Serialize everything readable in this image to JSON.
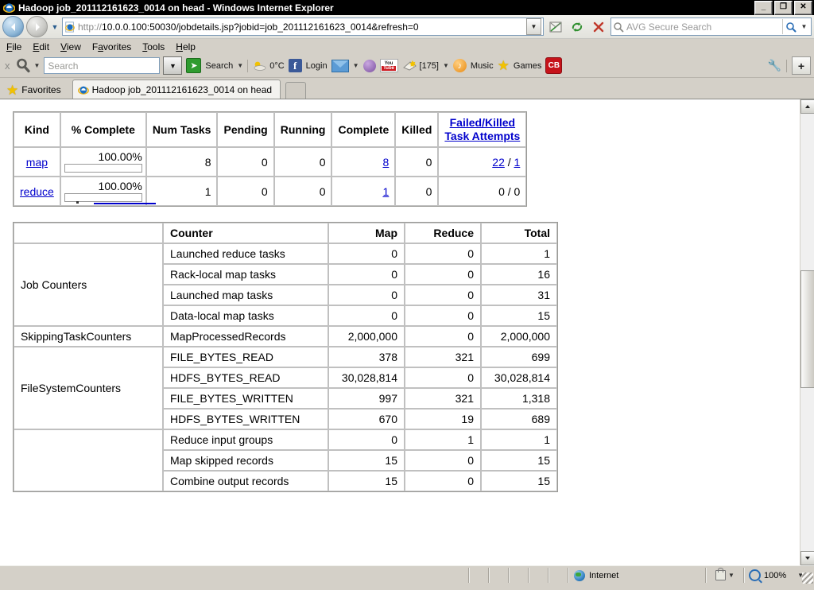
{
  "window": {
    "title": "Hadoop job_201112161623_0014 on head - Windows Internet Explorer",
    "minimize_label": "_",
    "maximize_label": "❐",
    "close_label": "✕"
  },
  "address_bar": {
    "back_label": "Back",
    "forward_label": "Forward",
    "history_label": "Recent Pages",
    "url_scheme": "http://",
    "url": "10.0.0.100:50030/jobdetails.jsp?jobid=job_201112161623_0014&refresh=0",
    "dropdown_label": "▼",
    "compat_label": "Compatibility View",
    "refresh_label": "Refresh",
    "stop_label": "Stop",
    "search_placeholder": "AVG Secure Search",
    "search_value": "",
    "search_go_label": "Search",
    "search_drop_label": "▼"
  },
  "menu": {
    "items": [
      {
        "prefix": "",
        "key": "F",
        "rest": "ile"
      },
      {
        "prefix": "",
        "key": "E",
        "rest": "dit"
      },
      {
        "prefix": "",
        "key": "V",
        "rest": "iew"
      },
      {
        "prefix": "F",
        "key": "a",
        "rest": "vorites"
      },
      {
        "prefix": "",
        "key": "T",
        "rest": "ools"
      },
      {
        "prefix": "",
        "key": "H",
        "rest": "elp"
      }
    ]
  },
  "avg_toolbar": {
    "close_label": "x",
    "logo_name": "magnifier-icon",
    "logo_drop": "▼",
    "search_placeholder": "Search",
    "search_value": "",
    "input_drop": "▼",
    "search_button_label": "Search",
    "search_button_drop": "▼",
    "weather_temp": "0°C",
    "facebook_label": "Login",
    "facebook_glyph": "f",
    "mail_drop": "▼",
    "notes_count": "[175]",
    "notes_drop": "▼",
    "music_label": "Music",
    "games_label": "Games",
    "cb_label": "CB",
    "wrench_label": "Options",
    "plus_label": "+"
  },
  "favorites_bar": {
    "label": "Favorites",
    "star_icon": "star-icon"
  },
  "tab": {
    "title": "Hadoop job_201112161623_0014 on head",
    "new_tab_label": ""
  },
  "page": {
    "task_summary": {
      "headers": [
        "Kind",
        "% Complete",
        "Num Tasks",
        "Pending",
        "Running",
        "Complete",
        "Killed",
        "Failed/Killed Task Attempts"
      ],
      "failed_killed_header_line1": "Failed/Killed",
      "failed_killed_header_line2": "Task Attempts",
      "rows": [
        {
          "kind": "map",
          "percent": "100.00%",
          "progress": 100,
          "num_tasks": "8",
          "pending": "0",
          "running": "0",
          "complete": "8",
          "killed": "0",
          "failed": "22",
          "separator": " / ",
          "killed_attempts": "1",
          "failed_is_link": true,
          "killed_attempts_is_link": true
        },
        {
          "kind": "reduce",
          "percent": "100.00%",
          "progress": 100,
          "num_tasks": "1",
          "pending": "0",
          "running": "0",
          "complete": "1",
          "killed": "0",
          "failed": "0",
          "separator": " / ",
          "killed_attempts": "0",
          "failed_is_link": false,
          "killed_attempts_is_link": false
        }
      ]
    },
    "counters": {
      "headers": [
        "",
        "Counter",
        "Map",
        "Reduce",
        "Total"
      ],
      "groups": [
        {
          "name": "Job Counters",
          "rows": [
            {
              "counter": "Launched reduce tasks",
              "map": "0",
              "reduce": "0",
              "total": "1"
            },
            {
              "counter": "Rack-local map tasks",
              "map": "0",
              "reduce": "0",
              "total": "16"
            },
            {
              "counter": "Launched map tasks",
              "map": "0",
              "reduce": "0",
              "total": "31"
            },
            {
              "counter": "Data-local map tasks",
              "map": "0",
              "reduce": "0",
              "total": "15"
            }
          ]
        },
        {
          "name": "SkippingTaskCounters",
          "rows": [
            {
              "counter": "MapProcessedRecords",
              "map": "2,000,000",
              "reduce": "0",
              "total": "2,000,000"
            }
          ]
        },
        {
          "name": "FileSystemCounters",
          "rows": [
            {
              "counter": "FILE_BYTES_READ",
              "map": "378",
              "reduce": "321",
              "total": "699"
            },
            {
              "counter": "HDFS_BYTES_READ",
              "map": "30,028,814",
              "reduce": "0",
              "total": "30,028,814"
            },
            {
              "counter": "FILE_BYTES_WRITTEN",
              "map": "997",
              "reduce": "321",
              "total": "1,318"
            },
            {
              "counter": "HDFS_BYTES_WRITTEN",
              "map": "670",
              "reduce": "19",
              "total": "689"
            }
          ]
        },
        {
          "name": "",
          "rows": [
            {
              "counter": "Reduce input groups",
              "map": "0",
              "reduce": "1",
              "total": "1"
            },
            {
              "counter": "Map skipped records",
              "map": "15",
              "reduce": "0",
              "total": "15"
            },
            {
              "counter": "Combine output records",
              "map": "15",
              "reduce": "0",
              "total": "15"
            }
          ]
        }
      ]
    }
  },
  "scrollbar": {
    "up_label": "▲",
    "down_label": "▼"
  },
  "status_bar": {
    "zone": "Internet",
    "zone_icon": "globe-icon",
    "protected_mode_icon": "lock-icon",
    "protected_drop": "▼",
    "zoom": "100%",
    "zoom_drop": "▼"
  },
  "colors": {
    "link": "#0000cc",
    "title_bar_bg": "#000000",
    "chrome_bg": "#d4d0c8",
    "page_bg": "#ffffff"
  }
}
